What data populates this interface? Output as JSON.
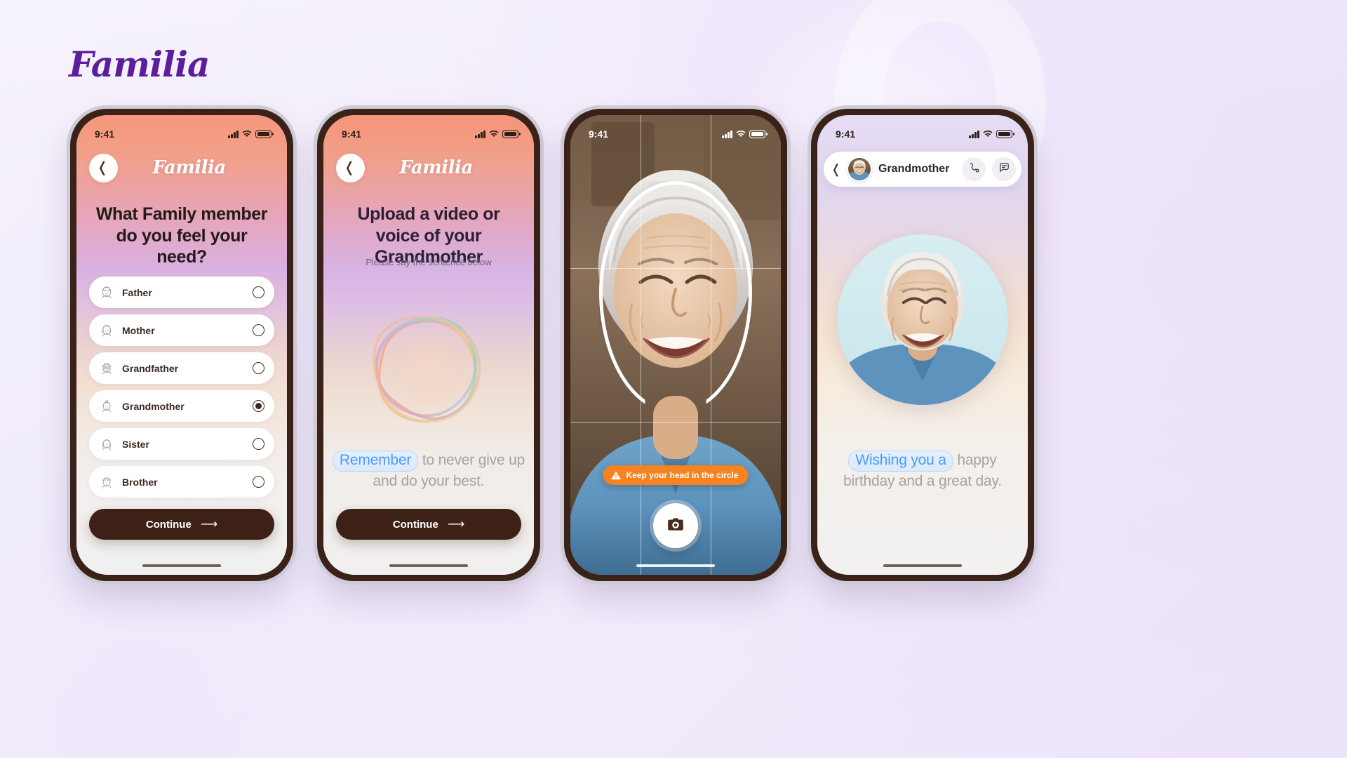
{
  "brand": {
    "name": "Familia"
  },
  "phones": [
    {
      "id": "select-family-member",
      "status": {
        "time": "9:41"
      },
      "header": {
        "logo": "Familia",
        "back_icon": "chevron-left-icon"
      },
      "title": "What Family member do you feel your need?",
      "options": [
        {
          "label": "Father",
          "icon": "avatar-father-icon",
          "selected": false
        },
        {
          "label": "Mother",
          "icon": "avatar-mother-icon",
          "selected": false
        },
        {
          "label": "Grandfather",
          "icon": "avatar-grandfather-icon",
          "selected": false
        },
        {
          "label": "Grandmother",
          "icon": "avatar-grandmother-icon",
          "selected": true
        },
        {
          "label": "Sister",
          "icon": "avatar-sister-icon",
          "selected": false
        },
        {
          "label": "Brother",
          "icon": "avatar-brother-icon",
          "selected": false
        }
      ],
      "cta": {
        "label": "Continue",
        "arrow": "arrow-right-icon"
      }
    },
    {
      "id": "upload-voice",
      "status": {
        "time": "9:41"
      },
      "header": {
        "logo": "Familia",
        "back_icon": "chevron-left-icon"
      },
      "title": "Upload a video or voice of your Grandmother",
      "subtitle": "Please say the sentence below",
      "waveform_icon": "voice-waveform-blob",
      "sentence": {
        "highlight": "Remember",
        "rest": " to never give up and do your best."
      },
      "cta": {
        "label": "Continue",
        "arrow": "arrow-right-icon"
      }
    },
    {
      "id": "camera-capture",
      "status": {
        "time": "9:41"
      },
      "warning": {
        "icon": "warning-triangle-icon",
        "text": "Keep your head in the circle"
      },
      "shutter": {
        "icon": "camera-icon"
      },
      "overlay": {
        "face_guide": "face-oval-guide",
        "grid": "rule-of-thirds-grid"
      }
    },
    {
      "id": "grandmother-profile",
      "status": {
        "time": "9:41"
      },
      "header": {
        "back_icon": "chevron-left-icon",
        "avatar": "grandmother-avatar",
        "name": "Grandmother",
        "call_icon": "phone-icon",
        "message_icon": "message-icon"
      },
      "portrait": "grandmother-portrait",
      "caption": {
        "highlight": "Wishing you a",
        "rest": " happy birthday and a great day."
      }
    }
  ],
  "colors": {
    "brand_purple": "#5b1f9e",
    "cta_brown": "#3d2117",
    "warning_orange": "#f5831f",
    "highlight_blue": "#4c9bf5"
  }
}
